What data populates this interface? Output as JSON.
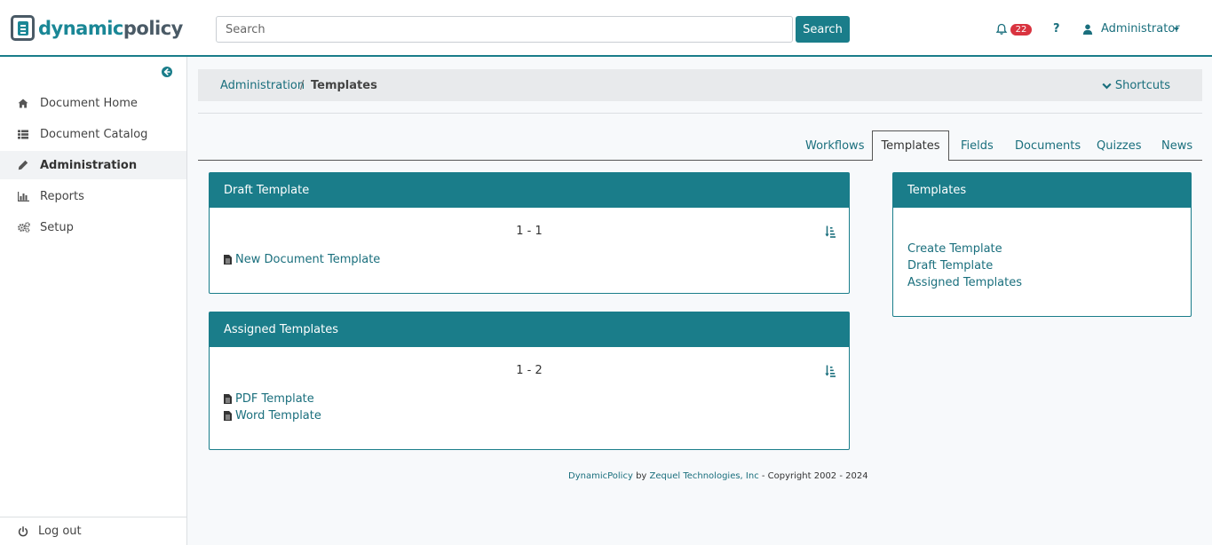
{
  "header": {
    "logo_part1": "dynamic",
    "logo_part2": "policy",
    "search_placeholder": "Search",
    "search_button": "Search",
    "notification_count": "22",
    "help_label": "?",
    "user_name": "Administrator"
  },
  "sidebar": {
    "items": [
      {
        "label": "Document Home",
        "icon": "home-icon"
      },
      {
        "label": "Document Catalog",
        "icon": "list-icon"
      },
      {
        "label": "Administration",
        "icon": "pencil-icon",
        "active": true
      },
      {
        "label": "Reports",
        "icon": "bar-chart-icon"
      },
      {
        "label": "Setup",
        "icon": "gears-icon"
      }
    ],
    "logout": "Log out"
  },
  "breadcrumb": {
    "parent": "Administration",
    "separator": "/",
    "current": "Templates",
    "shortcuts": "Shortcuts"
  },
  "tabs": [
    "Workflows",
    "Templates",
    "Fields",
    "Documents",
    "Quizzes",
    "News"
  ],
  "active_tab": "Templates",
  "draft_panel": {
    "title": "Draft Template",
    "pager": "1 - 1",
    "items": [
      "New Document Template"
    ]
  },
  "assigned_panel": {
    "title": "Assigned Templates",
    "pager": "1 - 2",
    "items": [
      "PDF Template",
      "Word Template"
    ]
  },
  "templates_panel": {
    "title": "Templates",
    "links": [
      "Create Template",
      "Draft Template",
      "Assigned Templates"
    ]
  },
  "footer": {
    "product": "DynamicPolicy",
    "by": "by",
    "company": "Zequel Technologies, Inc",
    "copyright": "- Copyright 2002 - 2024"
  },
  "colors": {
    "accent": "#1a7d8a",
    "link": "#1a6f7d",
    "badge": "#d9333f"
  }
}
